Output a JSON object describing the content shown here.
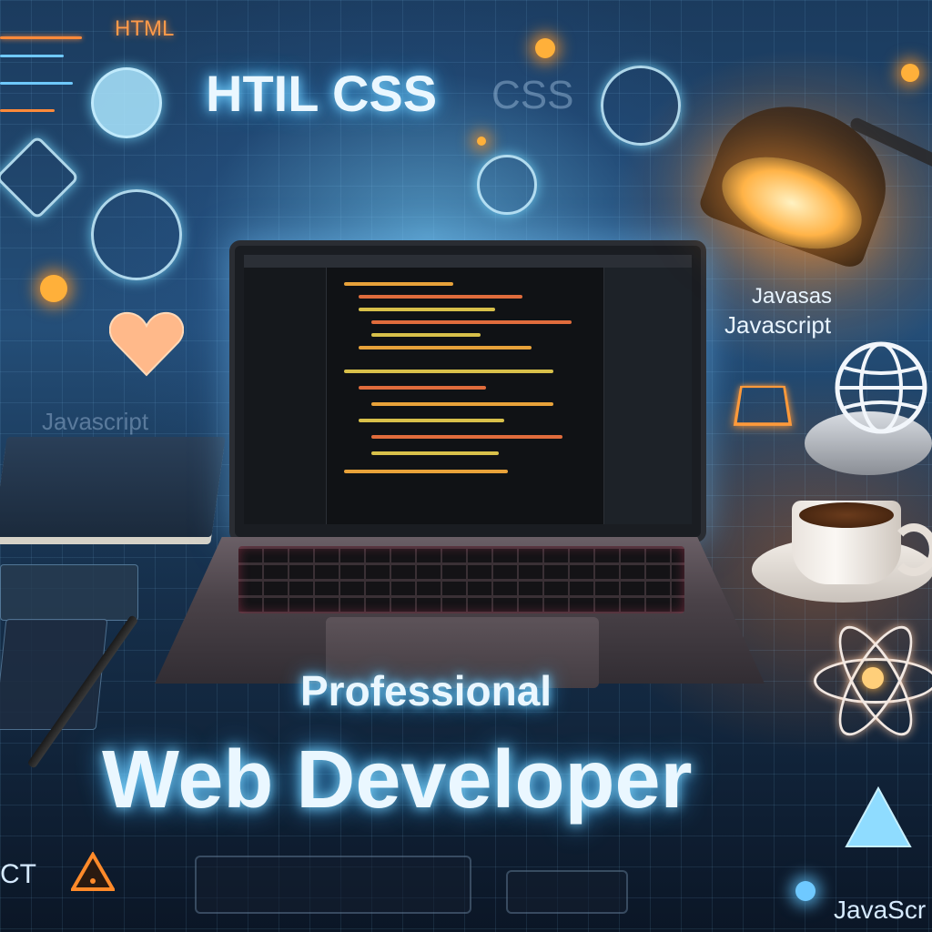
{
  "scene": {
    "top_left_label": "HTML",
    "header_label": "HTIL CSS",
    "faded_css_label": "CSS",
    "js_label_line1": "Javasas",
    "js_label_line2": "Javascript",
    "left_faded_label": "Javascript",
    "headline_small": "Professional",
    "headline_large": "Web Developer",
    "bottom_left_label": "CT",
    "bottom_right_label": "JavaScr"
  },
  "colors": {
    "accent_glow": "#7fd8ff",
    "lamp_orange": "#ffb347",
    "headline_text": "#eaf7ff"
  },
  "icons": [
    "atom-icon",
    "globe-icon",
    "heart-icon",
    "warning-triangle-icon",
    "play-triangle-icon",
    "coffee-cup-icon",
    "desk-lamp-icon",
    "laptop-icon",
    "book-icon",
    "pen-icon"
  ]
}
